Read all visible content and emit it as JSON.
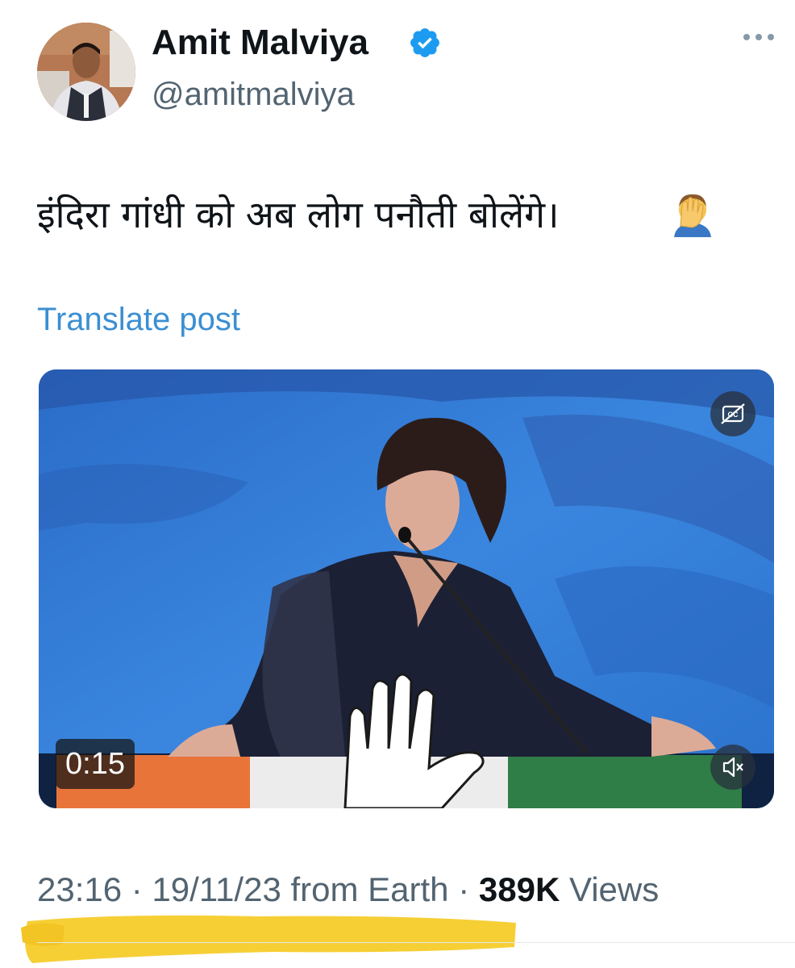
{
  "author": {
    "name": "Amit Malviya",
    "handle": "@amitmalviya",
    "verified": true
  },
  "icons": {
    "verified": "verified-badge-icon",
    "more": "more-options-icon",
    "captions": "closed-captions-icon",
    "mute": "muted-speaker-icon",
    "emoji": "face-palm-emoji"
  },
  "post": {
    "text": "इंदिरा गांधी को अब लोग पनौती बोलेंगे।",
    "translate_label": "Translate post"
  },
  "video": {
    "duration": "0:15"
  },
  "meta": {
    "time": "23:16",
    "date": "19/11/23",
    "source": "from Earth",
    "views_count": "389K",
    "views_label": "Views"
  },
  "colors": {
    "link": "#3b8fd2",
    "verified": "#1d9bf0",
    "secondary_text": "#536471",
    "highlight": "#f5cc2a"
  }
}
